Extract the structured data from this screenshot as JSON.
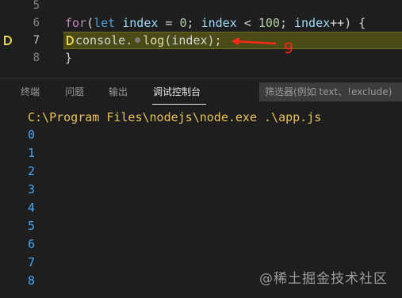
{
  "editor": {
    "lines": [
      {
        "number": "5"
      },
      {
        "number": "6",
        "code": {
          "kw": "for",
          "open": "(",
          "let": "let",
          "var1": "index",
          "eq": " = ",
          "n0": "0",
          "semi1": "; ",
          "var2": "index",
          "lt": " < ",
          "n100": "100",
          "semi2": "; ",
          "var3": "index",
          "inc": "++) {"
        }
      },
      {
        "number": "7",
        "code": {
          "obj": "console.",
          "fn": "log",
          "args": "(index);"
        }
      },
      {
        "number": "8",
        "code": {
          "brace": "}"
        }
      }
    ],
    "annotation_number": "9"
  },
  "panel": {
    "tabs": [
      "终端",
      "问题",
      "输出",
      "调试控制台"
    ],
    "active_tab": "调试控制台",
    "filter_placeholder": "筛选器(例如 text、!exclude)",
    "command": "C:\\Program Files\\nodejs\\node.exe .\\app.js",
    "output": [
      "0",
      "1",
      "2",
      "3",
      "4",
      "5",
      "6",
      "7",
      "8"
    ]
  },
  "watermark": "@稀土掘金技术社区",
  "colors": {
    "background": "#1e1e1e",
    "breakpoint": "#e8d44d",
    "current_line": "#4b4b18",
    "annotation": "#ff2a1a",
    "output_number": "#4aa6f2",
    "command_text": "#e8c35a"
  }
}
